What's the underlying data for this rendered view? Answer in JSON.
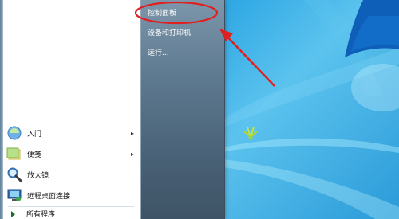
{
  "start_menu": {
    "right_items": [
      {
        "label": "控制面板"
      },
      {
        "label": "设备和打印机"
      },
      {
        "label": "运行..."
      }
    ],
    "programs": [
      {
        "label": "入门",
        "icon": "getting-started-icon",
        "has_submenu": true
      },
      {
        "label": "便笺",
        "icon": "sticky-notes-icon",
        "has_submenu": true
      },
      {
        "label": "放大镜",
        "icon": "magnifier-icon",
        "has_submenu": false
      },
      {
        "label": "远程桌面连接",
        "icon": "remote-desktop-icon",
        "has_submenu": false
      }
    ],
    "submenu_arrow": "▸",
    "all_programs_label": "所有程序"
  },
  "annotation": {
    "highlight_color": "#e02020",
    "target": "控制面板"
  }
}
